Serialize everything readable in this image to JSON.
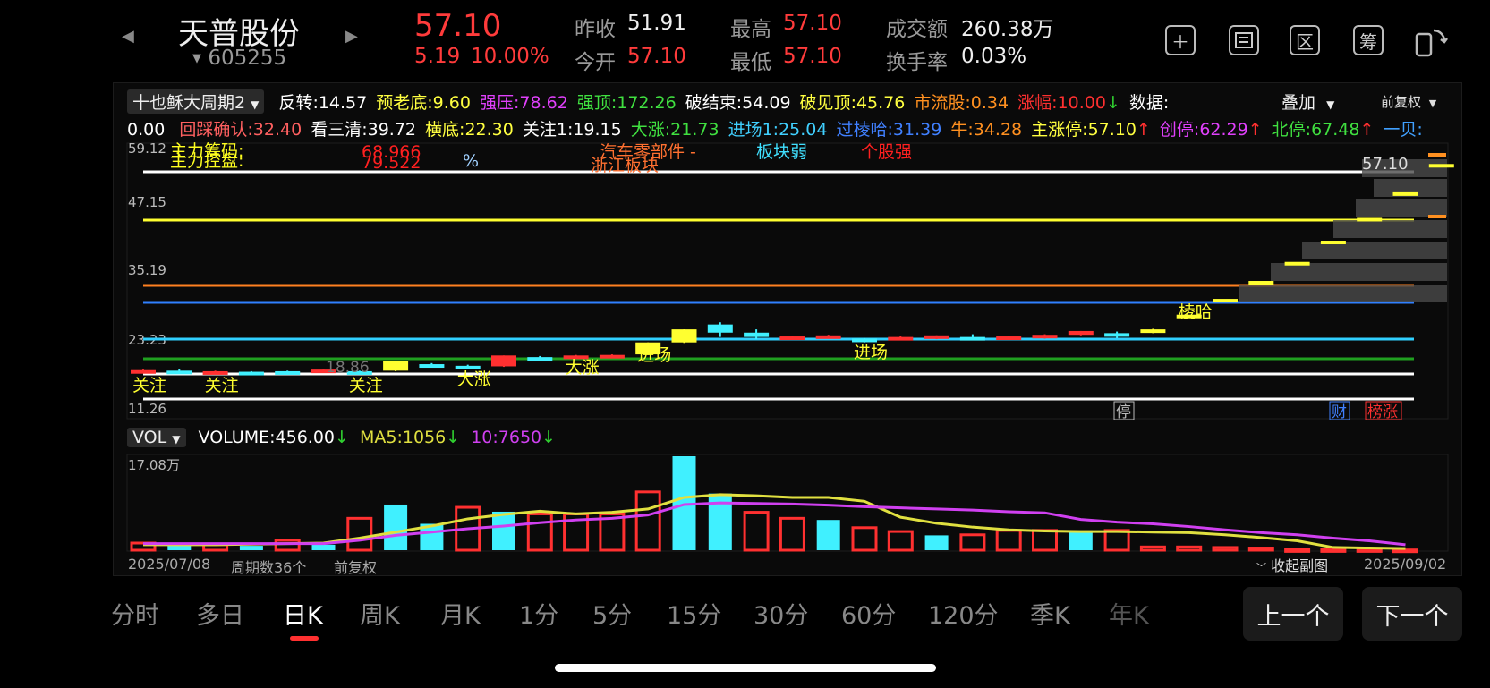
{
  "header": {
    "stock_name": "天普股份",
    "stock_code": "605255",
    "price": "57.10",
    "change": "5.19",
    "change_pct": "10.00%",
    "prev_close_label": "昨收",
    "prev_close": "51.91",
    "open_label": "今开",
    "open": "57.10",
    "high_label": "最高",
    "high": "57.10",
    "low_label": "最低",
    "low": "57.10",
    "turnover_label": "成交额",
    "turnover": "260.38万",
    "turnover_rate_label": "换手率",
    "turnover_rate": "0.03%",
    "icons": [
      "plus-icon",
      "draw-icon",
      "range-icon",
      "chips-icon",
      "rotate-icon"
    ],
    "tool_glyphs": {
      "range": "区",
      "chips": "筹"
    }
  },
  "indicators": {
    "dropdown": "十也稣大周期2",
    "row1": [
      {
        "label": "反转",
        "value": "14.57",
        "color": "#ffffff"
      },
      {
        "label": "预老底",
        "value": "9.60",
        "color": "#ffff40"
      },
      {
        "label": "强压",
        "value": "78.62",
        "color": "#e040fb"
      },
      {
        "label": "强顶",
        "value": "172.26",
        "color": "#40e040"
      },
      {
        "label": "破结束",
        "value": "54.09",
        "color": "#ffffff"
      },
      {
        "label": "破见顶",
        "value": "45.76",
        "color": "#ffff40"
      },
      {
        "label": "市流股",
        "value": "0.34",
        "color": "#ff9020"
      },
      {
        "label": "涨幅",
        "value": "10.00",
        "color": "#ff3030",
        "arrow": "↓",
        "arrow_color": "#30d030"
      },
      {
        "label": "数据",
        "value": "",
        "color": "#ffffff"
      }
    ],
    "overlay_label": "叠加",
    "adjust_label": "前复权",
    "row2_prefix": "0.00",
    "row2": [
      {
        "label": "回踩确认",
        "value": "32.40",
        "color": "#ff6060"
      },
      {
        "label": "看三清",
        "value": "39.72",
        "color": "#ffffff"
      },
      {
        "label": "横底",
        "value": "22.30",
        "color": "#ffff40"
      },
      {
        "label": "关注1",
        "value": "19.15",
        "color": "#ffffff"
      },
      {
        "label": "大涨",
        "value": "21.73",
        "color": "#40e040"
      },
      {
        "label": "进场1",
        "value": "25.04",
        "color": "#40d0ff"
      },
      {
        "label": "过棱哈",
        "value": "31.39",
        "color": "#4080ff"
      },
      {
        "label": "牛",
        "value": "34.28",
        "color": "#ff9020"
      },
      {
        "label": "主涨停",
        "value": "57.10",
        "color": "#ffff40",
        "arrow": "↑",
        "arrow_color": "#ff3030"
      },
      {
        "label": "创停",
        "value": "62.29",
        "color": "#e040fb",
        "arrow": "↑",
        "arrow_color": "#ff3030"
      },
      {
        "label": "北停",
        "value": "67.48",
        "color": "#40e040",
        "arrow": "↑",
        "arrow_color": "#ff3030"
      },
      {
        "label": "一贝",
        "value": "",
        "color": "#40a0ff"
      }
    ]
  },
  "main_chart": {
    "axis_labels": [
      "59.12",
      "47.15",
      "35.19",
      "23.23",
      "11.26"
    ],
    "top_annotations": [
      {
        "text": "主力筹码:",
        "color": "#ffff20"
      },
      {
        "text": "主力控盘:",
        "color": "#ffff20"
      },
      {
        "text": "68.966",
        "color": "#ff2020"
      },
      {
        "text": "79.522",
        "color": "#ff2020"
      },
      {
        "text": "%",
        "color": "#a0d0ff"
      },
      {
        "text": "汽车零部件 -",
        "color": "#ff7030"
      },
      {
        "text": "浙江板块",
        "color": "#ff7030"
      },
      {
        "text": "板块弱",
        "color": "#40e0ff"
      },
      {
        "text": "个股强",
        "color": "#ff2020"
      }
    ],
    "last_price_label": "57.10",
    "low_label": "18.86",
    "signals": [
      {
        "text": "关注",
        "idx": 0
      },
      {
        "text": "关注",
        "idx": 2
      },
      {
        "text": "关注",
        "idx": 6
      },
      {
        "text": "大涨",
        "idx": 9
      },
      {
        "text": "大涨",
        "idx": 12
      },
      {
        "text": "进场",
        "idx": 14
      },
      {
        "text": "进场",
        "idx": 20
      },
      {
        "text": "棱哈",
        "idx": 29
      }
    ],
    "bottom_tags": [
      {
        "text": "停",
        "color": "#bbbbbb"
      },
      {
        "text": "财",
        "color": "#4080ff"
      },
      {
        "text": "榜涨",
        "color": "#ff3030"
      }
    ]
  },
  "volume": {
    "dropdown": "VOL",
    "label": "VOLUME",
    "value": "456.00",
    "ma5_label": "MA5",
    "ma5": "1056",
    "ma10_label": "10",
    "ma10": "7650",
    "arrow": "↓",
    "max_label": "17.08万",
    "start_date": "2025/07/08",
    "end_date": "2025/09/02",
    "period_count": "周期数36个",
    "adjust_label": "前复权",
    "collapse_label": "收起副图"
  },
  "timeframes": [
    "分时",
    "多日",
    "日K",
    "周K",
    "月K",
    "1分",
    "5分",
    "15分",
    "30分",
    "60分",
    "120分",
    "季K",
    "年K"
  ],
  "active_timeframe": "日K",
  "nav": {
    "prev": "上一个",
    "next": "下一个"
  },
  "colors": {
    "up": "#ff3030",
    "down": "#40f0ff",
    "ma5": "#e0e040",
    "ma10": "#d040f0",
    "accent_red": "#ff3b3b"
  },
  "chart_data": {
    "type": "candlestick",
    "start_date": "2025/07/08",
    "end_date": "2025/09/02",
    "ylim": [
      11.26,
      59.12
    ],
    "candles": [
      {
        "o": 19.2,
        "c": 18.9,
        "h": 19.3,
        "l": 18.8,
        "dir": "up"
      },
      {
        "o": 19.0,
        "c": 19.1,
        "h": 19.4,
        "l": 18.7,
        "dir": "down"
      },
      {
        "o": 19.0,
        "c": 18.9,
        "h": 19.1,
        "l": 18.8,
        "dir": "up"
      },
      {
        "o": 18.9,
        "c": 18.9,
        "h": 19.0,
        "l": 18.9,
        "dir": "down"
      },
      {
        "o": 19.0,
        "c": 18.9,
        "h": 19.1,
        "l": 18.9,
        "dir": "down"
      },
      {
        "o": 19.0,
        "c": 19.3,
        "h": 19.3,
        "l": 18.9,
        "dir": "up"
      },
      {
        "o": 19.0,
        "c": 18.9,
        "h": 19.1,
        "l": 18.86,
        "dir": "down"
      },
      {
        "o": 19.1,
        "c": 20.8,
        "h": 20.8,
        "l": 19.0,
        "dir": "up"
      },
      {
        "o": 20.3,
        "c": 20.0,
        "h": 20.5,
        "l": 19.9,
        "dir": "down"
      },
      {
        "o": 20.0,
        "c": 19.8,
        "h": 20.2,
        "l": 19.6,
        "dir": "down"
      },
      {
        "o": 19.9,
        "c": 21.9,
        "h": 21.9,
        "l": 19.8,
        "dir": "up"
      },
      {
        "o": 21.6,
        "c": 21.4,
        "h": 21.8,
        "l": 21.2,
        "dir": "down"
      },
      {
        "o": 21.6,
        "c": 21.9,
        "h": 22.0,
        "l": 21.5,
        "dir": "up"
      },
      {
        "o": 21.7,
        "c": 22.0,
        "h": 22.1,
        "l": 21.6,
        "dir": "up"
      },
      {
        "o": 22.1,
        "c": 24.3,
        "h": 24.3,
        "l": 22.0,
        "dir": "up"
      },
      {
        "o": 24.3,
        "c": 26.7,
        "h": 26.7,
        "l": 24.2,
        "dir": "up"
      },
      {
        "o": 27.6,
        "c": 26.1,
        "h": 28.0,
        "l": 25.3,
        "dir": "down"
      },
      {
        "o": 26.1,
        "c": 25.3,
        "h": 26.7,
        "l": 24.9,
        "dir": "down"
      },
      {
        "o": 25.2,
        "c": 25.4,
        "h": 25.4,
        "l": 25.0,
        "dir": "up"
      },
      {
        "o": 25.1,
        "c": 25.6,
        "h": 25.7,
        "l": 25.0,
        "dir": "up"
      },
      {
        "o": 25.0,
        "c": 24.9,
        "h": 25.1,
        "l": 24.3,
        "dir": "down"
      },
      {
        "o": 24.8,
        "c": 25.3,
        "h": 25.4,
        "l": 24.7,
        "dir": "up"
      },
      {
        "o": 25.0,
        "c": 25.6,
        "h": 25.6,
        "l": 24.9,
        "dir": "up"
      },
      {
        "o": 25.3,
        "c": 24.9,
        "h": 25.8,
        "l": 24.7,
        "dir": "down"
      },
      {
        "o": 24.9,
        "c": 25.4,
        "h": 25.5,
        "l": 24.8,
        "dir": "up"
      },
      {
        "o": 25.1,
        "c": 25.7,
        "h": 25.8,
        "l": 25.0,
        "dir": "up"
      },
      {
        "o": 25.7,
        "c": 26.4,
        "h": 26.4,
        "l": 25.6,
        "dir": "up"
      },
      {
        "o": 26.0,
        "c": 25.8,
        "h": 26.3,
        "l": 25.1,
        "dir": "down"
      },
      {
        "o": 26.1,
        "c": 26.7,
        "h": 26.8,
        "l": 26.0,
        "dir": "up"
      },
      {
        "o": 29.4,
        "c": 29.4,
        "h": 29.4,
        "l": 29.4,
        "dir": "up"
      },
      {
        "o": 32.3,
        "c": 32.3,
        "h": 32.3,
        "l": 32.3,
        "dir": "up"
      },
      {
        "o": 35.6,
        "c": 35.6,
        "h": 35.6,
        "l": 35.6,
        "dir": "up"
      },
      {
        "o": 39.1,
        "c": 39.1,
        "h": 39.1,
        "l": 39.1,
        "dir": "up"
      },
      {
        "o": 43.0,
        "c": 43.0,
        "h": 43.0,
        "l": 43.0,
        "dir": "up"
      },
      {
        "o": 47.2,
        "c": 47.2,
        "h": 47.2,
        "l": 47.2,
        "dir": "up"
      },
      {
        "o": 51.9,
        "c": 51.9,
        "h": 51.9,
        "l": 51.9,
        "dir": "up"
      },
      {
        "o": 57.1,
        "c": 57.1,
        "h": 57.1,
        "l": 57.1,
        "dir": "up"
      }
    ],
    "volume": [
      1.3,
      1.0,
      1.0,
      0.8,
      1.8,
      1.0,
      5.8,
      8.3,
      4.8,
      7.8,
      7.0,
      6.6,
      6.6,
      6.6,
      10.6,
      17.08,
      10.3,
      6.9,
      5.8,
      5.5,
      4.1,
      3.4,
      2.7,
      2.8,
      3.6,
      3.6,
      3.6,
      3.6,
      0.6,
      0.6,
      0.5,
      0.4,
      0.1,
      0.1,
      0.1,
      0.05
    ],
    "volume_dir": [
      "up",
      "down",
      "up",
      "down",
      "up",
      "down",
      "up",
      "down",
      "down",
      "up",
      "down",
      "up",
      "up",
      "up",
      "up",
      "down",
      "down",
      "up",
      "up",
      "down",
      "up",
      "up",
      "down",
      "up",
      "up",
      "up",
      "down",
      "up",
      "up",
      "up",
      "up",
      "up",
      "up",
      "up",
      "up",
      "up"
    ],
    "ma5": [
      1.0,
      1.0,
      1.0,
      1.1,
      1.2,
      1.3,
      2.2,
      3.3,
      4.4,
      5.7,
      6.5,
      7.1,
      6.6,
      6.9,
      7.5,
      9.6,
      10.1,
      9.9,
      9.6,
      9.6,
      8.9,
      6.0,
      4.9,
      4.2,
      3.7,
      3.5,
      3.4,
      3.4,
      3.3,
      3.2,
      2.8,
      2.3,
      1.7,
      0.5,
      0.4,
      0.3
    ],
    "ma10": [
      1.2,
      1.2,
      1.2,
      1.2,
      1.2,
      1.2,
      1.8,
      2.7,
      3.3,
      3.9,
      4.4,
      5.0,
      5.5,
      5.8,
      6.4,
      8.3,
      8.6,
      8.5,
      8.4,
      8.2,
      7.9,
      7.7,
      7.5,
      7.3,
      7.0,
      6.8,
      5.6,
      5.1,
      4.8,
      4.3,
      3.7,
      3.2,
      2.8,
      2.2,
      1.7,
      1.0
    ]
  }
}
